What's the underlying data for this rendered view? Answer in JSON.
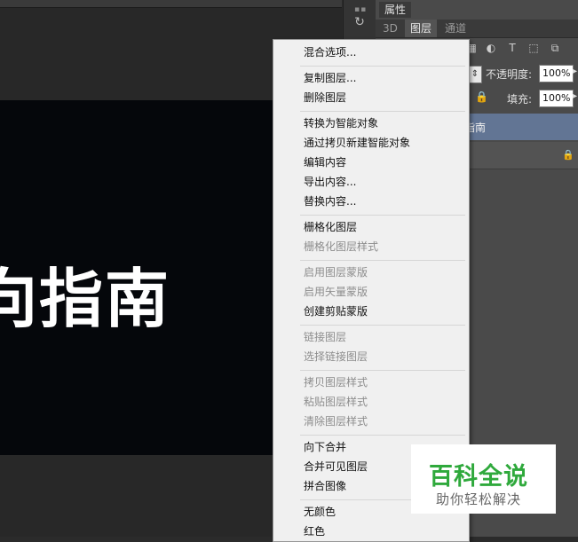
{
  "canvas": {
    "text": "向指南"
  },
  "panel": {
    "properties_tab": "属性",
    "tabs": [
      "3D",
      "图层",
      "通道"
    ],
    "active_tab": "图层",
    "opacity_label": "不透明度:",
    "opacity_value": "100%",
    "fill_label": "填充:",
    "fill_value": "100%",
    "selected_layer_name": "指南"
  },
  "context_menu": {
    "groups": [
      [
        {
          "label": "混合选项...",
          "enabled": true
        }
      ],
      [
        {
          "label": "复制图层...",
          "enabled": true
        },
        {
          "label": "删除图层",
          "enabled": true
        }
      ],
      [
        {
          "label": "转换为智能对象",
          "enabled": true
        },
        {
          "label": "通过拷贝新建智能对象",
          "enabled": true
        },
        {
          "label": "编辑内容",
          "enabled": true
        },
        {
          "label": "导出内容...",
          "enabled": true
        },
        {
          "label": "替换内容...",
          "enabled": true
        }
      ],
      [
        {
          "label": "栅格化图层",
          "enabled": true
        },
        {
          "label": "栅格化图层样式",
          "enabled": false
        }
      ],
      [
        {
          "label": "启用图层蒙版",
          "enabled": false
        },
        {
          "label": "启用矢量蒙版",
          "enabled": false
        },
        {
          "label": "创建剪贴蒙版",
          "enabled": true
        }
      ],
      [
        {
          "label": "链接图层",
          "enabled": false
        },
        {
          "label": "选择链接图层",
          "enabled": false
        }
      ],
      [
        {
          "label": "拷贝图层样式",
          "enabled": false
        },
        {
          "label": "粘贴图层样式",
          "enabled": false
        },
        {
          "label": "清除图层样式",
          "enabled": false
        }
      ],
      [
        {
          "label": "向下合并",
          "enabled": true
        },
        {
          "label": "合并可见图层",
          "enabled": true
        },
        {
          "label": "拼合图像",
          "enabled": true
        }
      ],
      [
        {
          "label": "无颜色",
          "enabled": true
        },
        {
          "label": "红色",
          "enabled": true
        }
      ]
    ]
  },
  "watermark": {
    "title": "百科全说",
    "subtitle": "助你轻松解决"
  },
  "icons": [
    "history-icon",
    "adjustment-filter-icon",
    "text-filter-icon",
    "shape-filter-icon",
    "smart-object-filter-icon",
    "lock-icon",
    "chevron-down-icon"
  ]
}
